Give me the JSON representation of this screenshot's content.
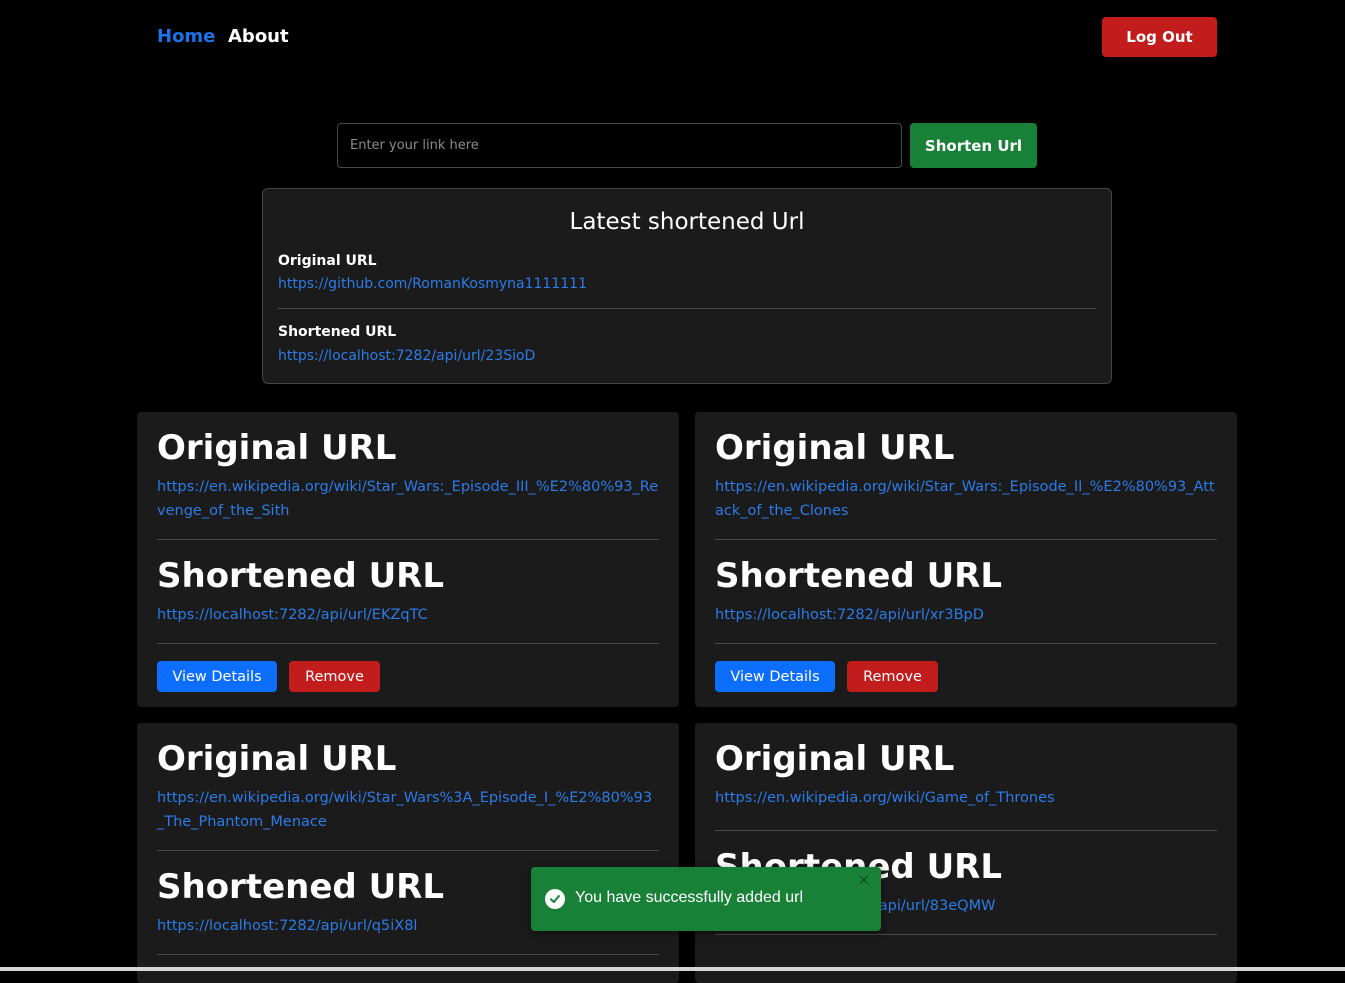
{
  "nav": {
    "home": "Home",
    "about": "About",
    "logout": "Log Out"
  },
  "shortener": {
    "placeholder": "Enter your link here",
    "button": "Shorten Url"
  },
  "latest": {
    "title": "Latest shortened Url",
    "original_label": "Original URL",
    "original_url": "https://github.com/RomanKosmyna1111111",
    "shortened_label": "Shortened URL",
    "shortened_url": "https://localhost:7282/api/url/23SioD"
  },
  "cards": [
    {
      "original_heading": "Original URL",
      "original_url": "https://en.wikipedia.org/wiki/Star_Wars:_Episode_III_%E2%80%93_Revenge_of_the_Sith",
      "shortened_heading": "Shortened URL",
      "shortened_url": "https://localhost:7282/api/url/EKZqTC",
      "view_label": "View Details",
      "remove_label": "Remove"
    },
    {
      "original_heading": "Original URL",
      "original_url": "https://en.wikipedia.org/wiki/Star_Wars:_Episode_II_%E2%80%93_Attack_of_the_Clones",
      "shortened_heading": "Shortened URL",
      "shortened_url": "https://localhost:7282/api/url/xr3BpD",
      "view_label": "View Details",
      "remove_label": "Remove"
    },
    {
      "original_heading": "Original URL",
      "original_url": "https://en.wikipedia.org/wiki/Star_Wars%3A_Episode_I_%E2%80%93_The_Phantom_Menace",
      "shortened_heading": "Shortened URL",
      "shortened_url": "https://localhost:7282/api/url/q5iX8l"
    },
    {
      "original_heading": "Original URL",
      "original_url": "https://en.wikipedia.org/wiki/Game_of_Thrones",
      "shortened_heading": "Shortened URL",
      "shortened_url": "https://localhost:7282/api/url/83eQMW"
    }
  ],
  "toast": {
    "message": "You have successfully added url",
    "icon": "check-circle-icon",
    "close": "✕"
  },
  "colors": {
    "accent_blue": "#0d6efd",
    "danger_red": "#c21c1c",
    "success_green": "#198038",
    "link_blue": "#2b7be8"
  }
}
